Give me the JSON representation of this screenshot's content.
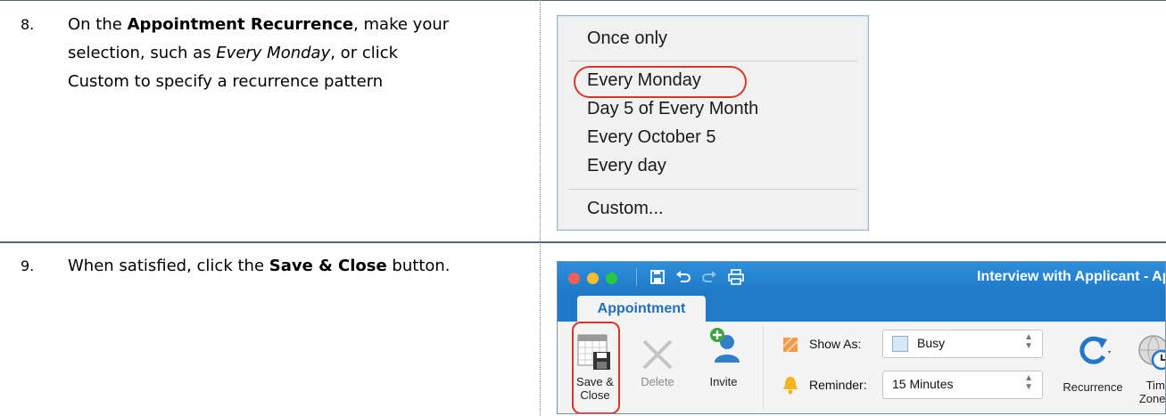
{
  "rows": [
    {
      "number": "8.",
      "lines": [
        {
          "before": "On the ",
          "bold": "Appointment Recurrence",
          "after": ", make your"
        },
        {
          "before": "selection, such as ",
          "italic": "Every Monday",
          "after": ", or click"
        },
        {
          "before": "Custom to specify a recurrence pattern"
        }
      ]
    },
    {
      "number": "9.",
      "lines": [
        {
          "before": "When satisfied, click the ",
          "bold": "Save & Close",
          "after": " button."
        }
      ]
    }
  ],
  "recurrence_menu": {
    "items": [
      "Once only",
      "Every Monday",
      "Day 5 of Every Month",
      "Every October 5",
      "Every day",
      "Custom..."
    ],
    "highlighted": "Every Monday",
    "highlight_color": "#d9362b"
  },
  "outlook": {
    "window_title": "Interview with Applicant - Appo",
    "tab": "Appointment",
    "buttons": {
      "save_close_line1": "Save &",
      "save_close_line2": "Close",
      "delete": "Delete",
      "invite": "Invite",
      "recurrence": "Recurrence",
      "time_zones_line1": "Time",
      "time_zones_line2": "Zones"
    },
    "show_as_label": "Show As:",
    "show_as_value": "Busy",
    "reminder_label": "Reminder:",
    "reminder_value": "15 Minutes",
    "accent_color": "#1f78c8"
  }
}
